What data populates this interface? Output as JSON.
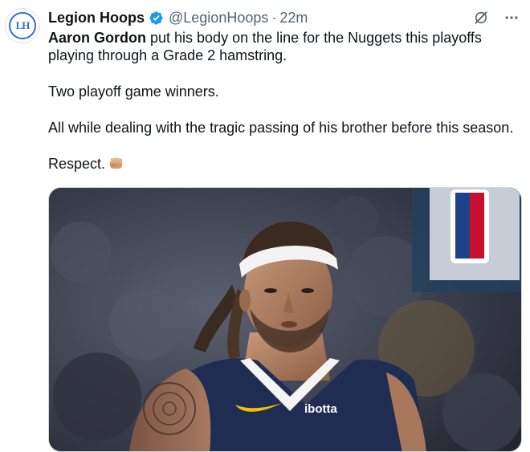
{
  "tweet": {
    "author_name": "Legion Hoops",
    "author_handle": "@LegionHoops",
    "separator": "·",
    "time_ago": "22m",
    "avatar_text": "LH",
    "mention": "Aaron Gordon",
    "line1_rest": " put his body on the line for the Nuggets this playoffs playing through a Grade 2 hamstring.",
    "line2": "Two playoff game winners.",
    "line3": "All while dealing with the tragic passing of his brother before this season.",
    "line4": "Respect."
  },
  "media": {
    "jersey_sponsor": "ibotta"
  },
  "icons": {
    "verified": "verified-badge-icon",
    "grok": "grok-icon",
    "more": "more-options-icon",
    "fist": "fist-emoji-icon"
  },
  "colors": {
    "verified": "#1d9bf0",
    "text_primary": "#0f1419",
    "text_secondary": "#536471"
  }
}
